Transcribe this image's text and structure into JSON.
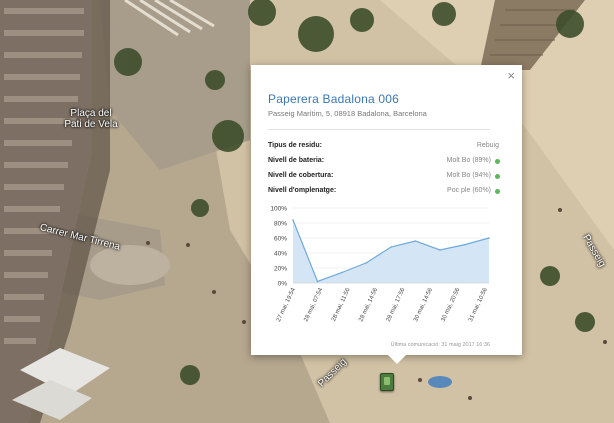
{
  "map": {
    "labels": {
      "square": "Plaça del Pati de Vela",
      "street1": "Carrer Mar Tirrena",
      "street2": "Passeig",
      "street3": "Passeig"
    }
  },
  "popup": {
    "close_icon": "×",
    "title": "Paperera Badalona 006",
    "address": "Passeig Marítim, 5, 08918 Badalona, Barcelona",
    "rows": [
      {
        "label": "Tipus de residu:",
        "value": "Rebuig",
        "status": ""
      },
      {
        "label": "Nivell de bateria:",
        "value": "Molt Bo (89%)",
        "status": "#5cb85c"
      },
      {
        "label": "Nivell de cobertura:",
        "value": "Molt Bo (94%)",
        "status": "#5cb85c"
      },
      {
        "label": "Nivell d'omplenatge:",
        "value": "Poc ple (60%)",
        "status": "#5cb85c"
      }
    ],
    "footer": "Última comunicació: 31 maig 2017 16:36"
  },
  "chart_data": {
    "type": "area",
    "x": [
      "27 mai, 19:54",
      "28 mai, 07:54",
      "28 mai, 11:56",
      "28 mai, 14:56",
      "28 mai, 17:56",
      "30 mai, 14:56",
      "30 mai, 20:56",
      "31 mai, 10:56"
    ],
    "values": [
      84,
      2,
      14,
      27,
      48,
      56,
      44,
      51,
      60
    ],
    "yticks": [
      "0%",
      "20%",
      "40%",
      "60%",
      "80%",
      "100%"
    ],
    "ylim": [
      0,
      100
    ],
    "colors": {
      "line": "#6fa9dc",
      "fill": "#cfe3f5"
    }
  }
}
